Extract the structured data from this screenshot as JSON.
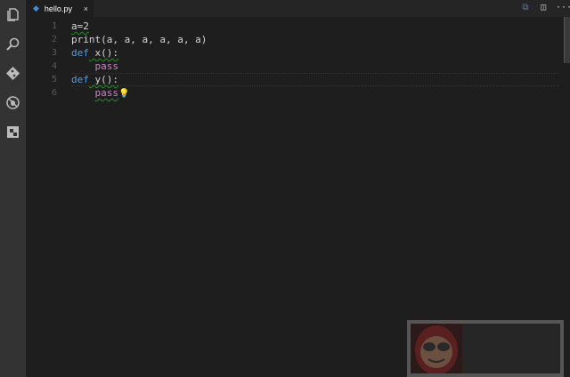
{
  "activity_bar": {
    "items": [
      "explorer-icon",
      "search-icon",
      "git-icon",
      "debug-icon",
      "extensions-icon"
    ]
  },
  "tab": {
    "filename": "hello.py",
    "close": "×"
  },
  "tab_actions": {
    "more": "···"
  },
  "lines": [
    {
      "n": "1",
      "text": "a=2"
    },
    {
      "n": "2",
      "text": "print(a, a, a, a, a, a)"
    },
    {
      "n": "3",
      "kw": "def",
      "rest": " x():"
    },
    {
      "n": "4",
      "indent": "    ",
      "kw2": "pass"
    },
    {
      "n": "5",
      "kw": "def",
      "rest": " y():"
    },
    {
      "n": "6",
      "indent": "    ",
      "kw2": "pass"
    }
  ],
  "colors": {
    "keyword": "#569cd6",
    "pass": "#c586c0",
    "bg": "#1e1e1e"
  }
}
